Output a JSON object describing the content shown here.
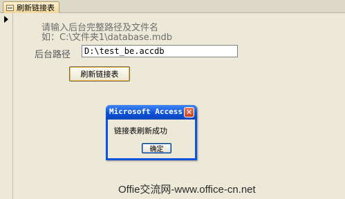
{
  "tab": {
    "label": "刷新链接表",
    "icon": "form-icon"
  },
  "form": {
    "hint_line1": "请输入后台完整路径及文件名",
    "hint_line2": "如：C:\\文件夹1\\database.mdb",
    "path_label": "后台路径",
    "path_value": "D:\\test_be.accdb",
    "refresh_button": "刷新链接表"
  },
  "msgbox": {
    "title": "Microsoft Access",
    "message": "链接表刷新成功",
    "ok_label": "确定",
    "close_glyph": "✕"
  },
  "watermark": "Offie交流网-www.office-cn.net",
  "colors": {
    "background": "#ece9d8",
    "titlebar": "#0a55e0",
    "close": "#c9411c"
  }
}
